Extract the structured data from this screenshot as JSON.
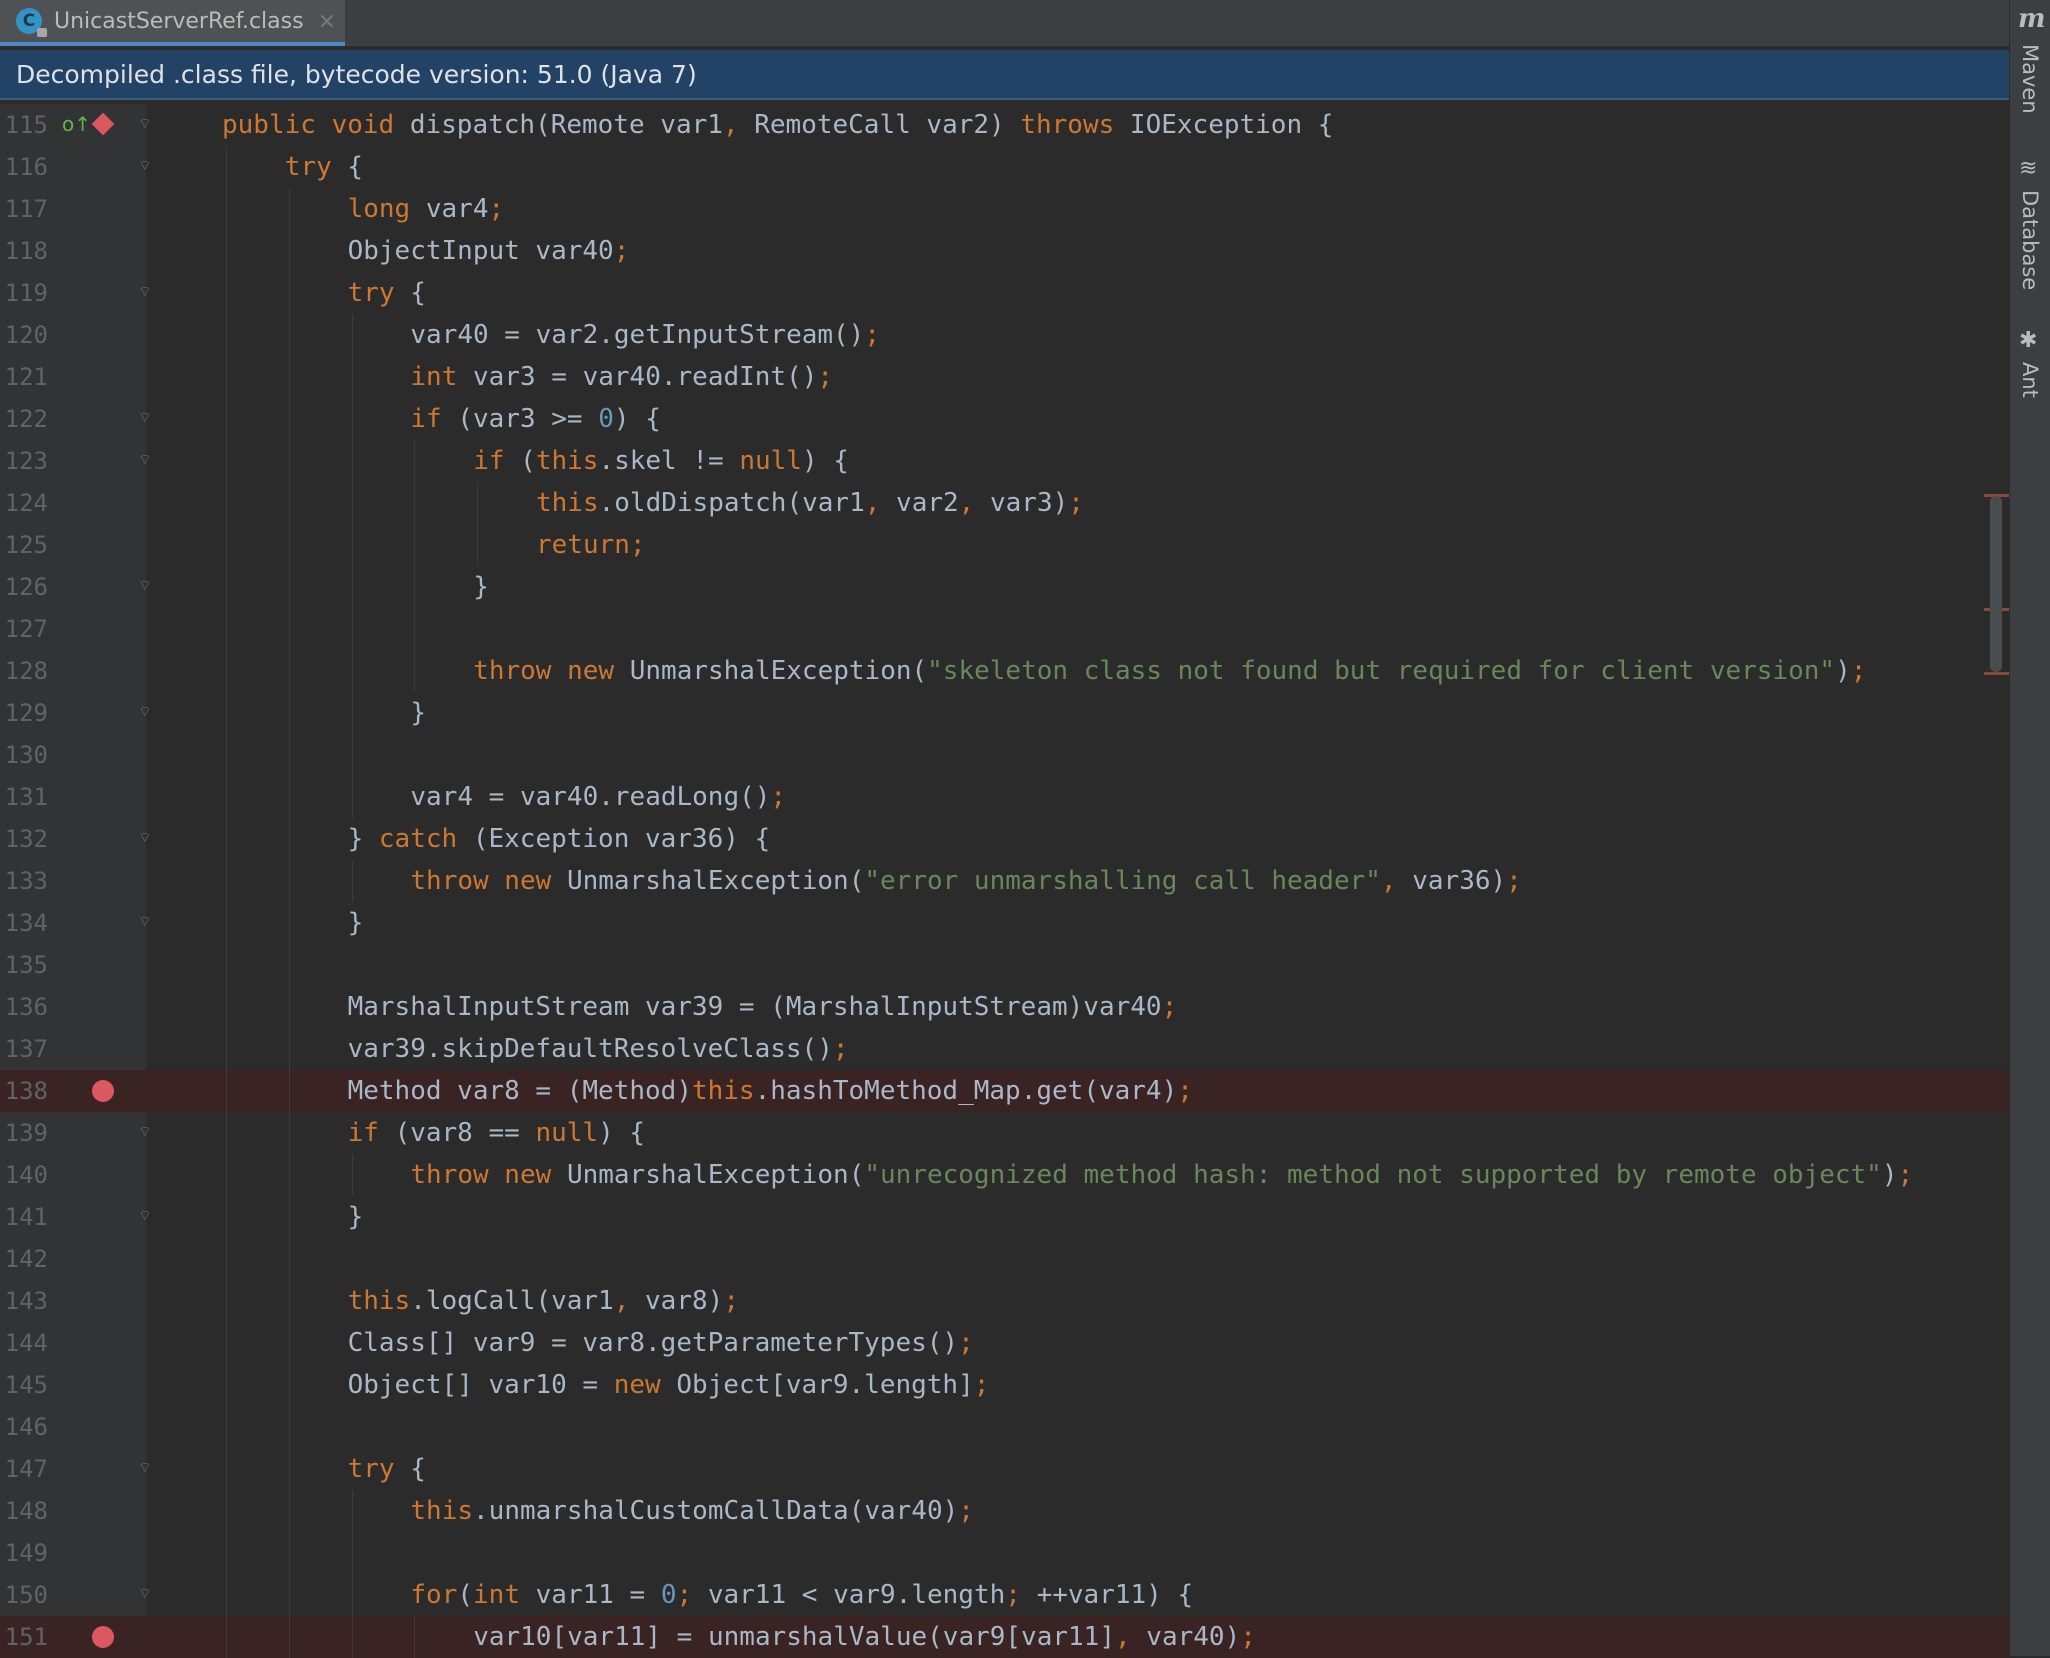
{
  "tab": {
    "icon": "class-file-icon",
    "icon_letter": "C",
    "label": "UnicastServerRef.class",
    "close": "×"
  },
  "banner": {
    "text": "Decompiled .class file, bytecode version: 51.0 (Java 7)"
  },
  "tool_windows": {
    "maven_icon": "m",
    "maven": "Maven",
    "database": "Database",
    "ant": "Ant"
  },
  "colors": {
    "keyword": "#cc7832",
    "string": "#6a8759",
    "number": "#6897bb",
    "identifier": "#a9b7c6",
    "breakpoint": "#db5860"
  },
  "lines": [
    {
      "n": "115",
      "indent": 1,
      "bp": false,
      "marker": "override-breakpoint",
      "fold": true,
      "tokens": [
        [
          "k",
          "public void "
        ],
        [
          "i",
          "dispatch(Remote var1"
        ],
        [
          "k",
          ", "
        ],
        [
          "i",
          "RemoteCall var2) "
        ],
        [
          "k",
          "throws "
        ],
        [
          "i",
          "IOException {"
        ]
      ]
    },
    {
      "n": "116",
      "indent": 2,
      "bp": false,
      "fold": true,
      "tokens": [
        [
          "k",
          "try "
        ],
        [
          "i",
          "{"
        ]
      ]
    },
    {
      "n": "117",
      "indent": 3,
      "bp": false,
      "tokens": [
        [
          "k",
          "long "
        ],
        [
          "i",
          "var4"
        ],
        [
          "k",
          ";"
        ]
      ]
    },
    {
      "n": "118",
      "indent": 3,
      "bp": false,
      "tokens": [
        [
          "i",
          "ObjectInput var40"
        ],
        [
          "k",
          ";"
        ]
      ]
    },
    {
      "n": "119",
      "indent": 3,
      "bp": false,
      "fold": true,
      "tokens": [
        [
          "k",
          "try "
        ],
        [
          "i",
          "{"
        ]
      ]
    },
    {
      "n": "120",
      "indent": 4,
      "bp": false,
      "tokens": [
        [
          "i",
          "var40 = var2.getInputStream()"
        ],
        [
          "k",
          ";"
        ]
      ]
    },
    {
      "n": "121",
      "indent": 4,
      "bp": false,
      "tokens": [
        [
          "k",
          "int "
        ],
        [
          "i",
          "var3 = var40.readInt()"
        ],
        [
          "k",
          ";"
        ]
      ]
    },
    {
      "n": "122",
      "indent": 4,
      "bp": false,
      "fold": true,
      "tokens": [
        [
          "k",
          "if "
        ],
        [
          "i",
          "(var3 >= "
        ],
        [
          "n",
          "0"
        ],
        [
          "i",
          ") {"
        ]
      ]
    },
    {
      "n": "123",
      "indent": 5,
      "bp": false,
      "fold": true,
      "tokens": [
        [
          "k",
          "if "
        ],
        [
          "i",
          "("
        ],
        [
          "k",
          "this"
        ],
        [
          "i",
          ".skel != "
        ],
        [
          "k",
          "null"
        ],
        [
          "i",
          ") {"
        ]
      ]
    },
    {
      "n": "124",
      "indent": 6,
      "bp": false,
      "tokens": [
        [
          "k",
          "this"
        ],
        [
          "i",
          ".oldDispatch(var1"
        ],
        [
          "k",
          ", "
        ],
        [
          "i",
          "var2"
        ],
        [
          "k",
          ", "
        ],
        [
          "i",
          "var3)"
        ],
        [
          "k",
          ";"
        ]
      ]
    },
    {
      "n": "125",
      "indent": 6,
      "bp": false,
      "tokens": [
        [
          "k",
          "return;"
        ]
      ]
    },
    {
      "n": "126",
      "indent": 5,
      "bp": false,
      "fold": true,
      "tokens": [
        [
          "i",
          "}"
        ]
      ]
    },
    {
      "n": "127",
      "indent": 5,
      "bp": false,
      "tokens": []
    },
    {
      "n": "128",
      "indent": 5,
      "bp": false,
      "tokens": [
        [
          "k",
          "throw new "
        ],
        [
          "i",
          "UnmarshalException("
        ],
        [
          "s",
          "\"skeleton class not found but required for client version\""
        ],
        [
          "i",
          ")"
        ],
        [
          "k",
          ";"
        ]
      ]
    },
    {
      "n": "129",
      "indent": 4,
      "bp": false,
      "fold": true,
      "tokens": [
        [
          "i",
          "}"
        ]
      ]
    },
    {
      "n": "130",
      "indent": 4,
      "bp": false,
      "tokens": []
    },
    {
      "n": "131",
      "indent": 4,
      "bp": false,
      "tokens": [
        [
          "i",
          "var4 = var40.readLong()"
        ],
        [
          "k",
          ";"
        ]
      ]
    },
    {
      "n": "132",
      "indent": 3,
      "bp": false,
      "fold": true,
      "tokens": [
        [
          "i",
          "} "
        ],
        [
          "k",
          "catch "
        ],
        [
          "i",
          "(Exception var36) {"
        ]
      ]
    },
    {
      "n": "133",
      "indent": 4,
      "bp": false,
      "tokens": [
        [
          "k",
          "throw new "
        ],
        [
          "i",
          "UnmarshalException("
        ],
        [
          "s",
          "\"error unmarshalling call header\""
        ],
        [
          "k",
          ", "
        ],
        [
          "i",
          "var36)"
        ],
        [
          "k",
          ";"
        ]
      ]
    },
    {
      "n": "134",
      "indent": 3,
      "bp": false,
      "fold": true,
      "tokens": [
        [
          "i",
          "}"
        ]
      ]
    },
    {
      "n": "135",
      "indent": 3,
      "bp": false,
      "tokens": []
    },
    {
      "n": "136",
      "indent": 3,
      "bp": false,
      "tokens": [
        [
          "i",
          "MarshalInputStream var39 = (MarshalInputStream)var40"
        ],
        [
          "k",
          ";"
        ]
      ]
    },
    {
      "n": "137",
      "indent": 3,
      "bp": false,
      "tokens": [
        [
          "i",
          "var39.skipDefaultResolveClass()"
        ],
        [
          "k",
          ";"
        ]
      ]
    },
    {
      "n": "138",
      "indent": 3,
      "bp": true,
      "marker": "breakpoint",
      "tokens": [
        [
          "i",
          "Method var8 = (Method)"
        ],
        [
          "k",
          "this"
        ],
        [
          "i",
          ".hashToMethod_Map.get(var4)"
        ],
        [
          "k",
          ";"
        ]
      ]
    },
    {
      "n": "139",
      "indent": 3,
      "bp": false,
      "fold": true,
      "tokens": [
        [
          "k",
          "if "
        ],
        [
          "i",
          "(var8 == "
        ],
        [
          "k",
          "null"
        ],
        [
          "i",
          ") {"
        ]
      ]
    },
    {
      "n": "140",
      "indent": 4,
      "bp": false,
      "tokens": [
        [
          "k",
          "throw new "
        ],
        [
          "i",
          "UnmarshalException("
        ],
        [
          "s",
          "\"unrecognized method hash: method not supported by remote object\""
        ],
        [
          "i",
          ")"
        ],
        [
          "k",
          ";"
        ]
      ]
    },
    {
      "n": "141",
      "indent": 3,
      "bp": false,
      "fold": true,
      "tokens": [
        [
          "i",
          "}"
        ]
      ]
    },
    {
      "n": "142",
      "indent": 3,
      "bp": false,
      "tokens": []
    },
    {
      "n": "143",
      "indent": 3,
      "bp": false,
      "tokens": [
        [
          "k",
          "this"
        ],
        [
          "i",
          ".logCall(var1"
        ],
        [
          "k",
          ", "
        ],
        [
          "i",
          "var8)"
        ],
        [
          "k",
          ";"
        ]
      ]
    },
    {
      "n": "144",
      "indent": 3,
      "bp": false,
      "tokens": [
        [
          "i",
          "Class[] var9 = var8.getParameterTypes()"
        ],
        [
          "k",
          ";"
        ]
      ]
    },
    {
      "n": "145",
      "indent": 3,
      "bp": false,
      "tokens": [
        [
          "i",
          "Object[] var10 = "
        ],
        [
          "k",
          "new "
        ],
        [
          "i",
          "Object[var9.length]"
        ],
        [
          "k",
          ";"
        ]
      ]
    },
    {
      "n": "146",
      "indent": 3,
      "bp": false,
      "tokens": []
    },
    {
      "n": "147",
      "indent": 3,
      "bp": false,
      "fold": true,
      "tokens": [
        [
          "k",
          "try "
        ],
        [
          "i",
          "{"
        ]
      ]
    },
    {
      "n": "148",
      "indent": 4,
      "bp": false,
      "tokens": [
        [
          "k",
          "this"
        ],
        [
          "i",
          ".unmarshalCustomCallData(var40)"
        ],
        [
          "k",
          ";"
        ]
      ]
    },
    {
      "n": "149",
      "indent": 4,
      "bp": false,
      "tokens": []
    },
    {
      "n": "150",
      "indent": 4,
      "bp": false,
      "fold": true,
      "tokens": [
        [
          "k",
          "for"
        ],
        [
          "i",
          "("
        ],
        [
          "k",
          "int "
        ],
        [
          "i",
          "var11 = "
        ],
        [
          "n",
          "0"
        ],
        [
          "k",
          "; "
        ],
        [
          "i",
          "var11 < var9.length"
        ],
        [
          "k",
          "; "
        ],
        [
          "i",
          "++var11) {"
        ]
      ]
    },
    {
      "n": "151",
      "indent": 5,
      "bp": true,
      "marker": "breakpoint",
      "tokens": [
        [
          "i",
          "var10[var11] = unmarshalValue(var9[var11]"
        ],
        [
          "k",
          ", "
        ],
        [
          "i",
          "var40)"
        ],
        [
          "k",
          ";"
        ]
      ]
    }
  ]
}
